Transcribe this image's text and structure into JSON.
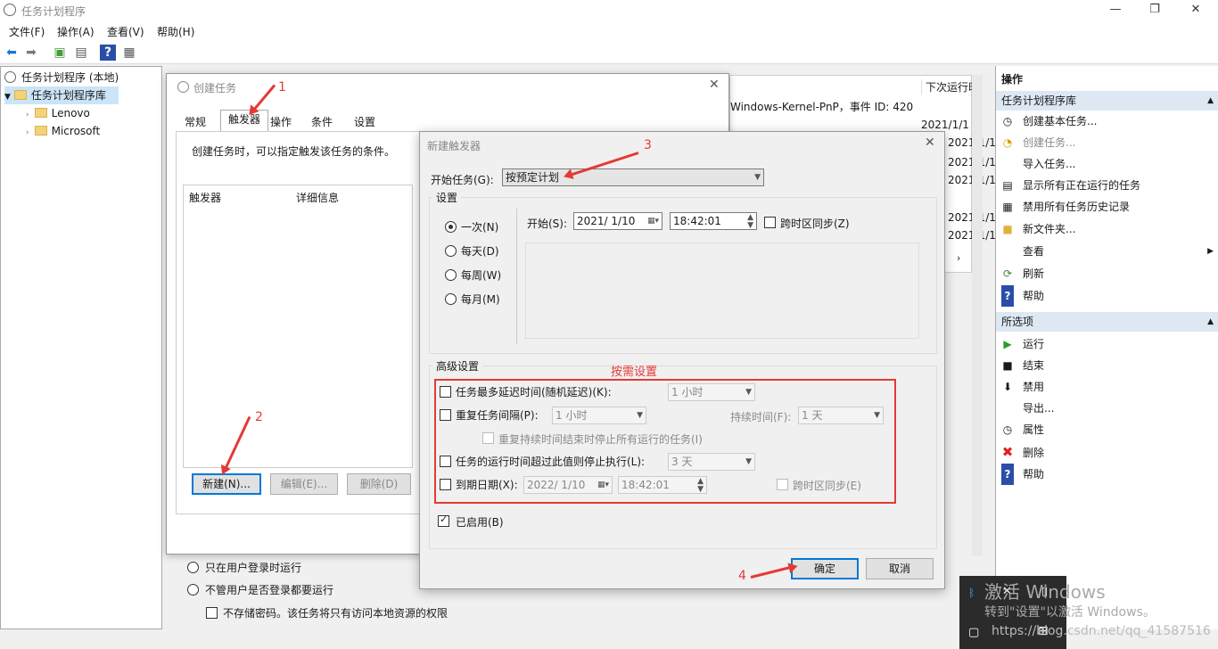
{
  "window": {
    "title": "任务计划程序"
  },
  "menu": [
    "文件(F)",
    "操作(A)",
    "查看(V)",
    "帮助(H)"
  ],
  "tree": {
    "root": "任务计划程序 (本地)",
    "library": "任务计划程序库",
    "children": [
      "Lenovo",
      "Microsoft"
    ]
  },
  "list": {
    "header": "下次运行时",
    "event": "Windows-Kernel-PnP，事件 ID: 420",
    "dates": [
      "2021/1/1",
      "2021/1/1(",
      "2021/1/1",
      "2021/1/1",
      "2021/1/1(",
      "2021/1/1("
    ]
  },
  "right": {
    "title": "操作",
    "section1": "任务计划程序库",
    "items1": [
      "创建基本任务...",
      "创建任务...",
      "导入任务...",
      "显示所有正在运行的任务",
      "禁用所有任务历史记录",
      "新文件夹...",
      "查看",
      "刷新",
      "帮助"
    ],
    "section2": "所选项",
    "items2": [
      "运行",
      "结束",
      "禁用",
      "导出...",
      "属性",
      "删除",
      "帮助"
    ]
  },
  "dlg1": {
    "title": "创建任务",
    "tabs": [
      "常规",
      "触发器",
      "操作",
      "条件",
      "设置"
    ],
    "desc": "创建任务时，可以指定触发该任务的条件。",
    "cols": [
      "触发器",
      "详细信息"
    ],
    "buttons": [
      "新建(N)...",
      "编辑(E)...",
      "删除(D)"
    ]
  },
  "bg": {
    "opt1": "只在用户登录时运行",
    "opt2": "不管用户是否登录都要运行",
    "opt3": "不存储密码。该任务将只有访问本地资源的权限"
  },
  "dlg2": {
    "title": "新建触发器",
    "start_label": "开始任务(G):",
    "start_value": "按预定计划",
    "settings": "设置",
    "radios": [
      "一次(N)",
      "每天(D)",
      "每周(W)",
      "每月(M)"
    ],
    "start_at": "开始(S):",
    "date": "2021/ 1/10",
    "time": "18:42:01",
    "sync": "跨时区同步(Z)",
    "advanced": "高级设置",
    "delay": "任务最多延迟时间(随机延迟)(K):",
    "delay_val": "1 小时",
    "repeat": "重复任务间隔(P):",
    "repeat_val": "1 小时",
    "duration": "持续时间(F):",
    "duration_val": "1 天",
    "stop_all": "重复持续时间结束时停止所有运行的任务(I)",
    "stop_if": "任务的运行时间超过此值则停止执行(L):",
    "stop_val": "3 天",
    "expire": "到期日期(X):",
    "expire_date": "2022/ 1/10",
    "expire_time": "18:42:01",
    "expire_sync": "跨时区同步(E)",
    "enabled": "已启用(B)",
    "ok": "确定",
    "cancel": "取消"
  },
  "annotations": {
    "n1": "1",
    "n2": "2",
    "n3": "3",
    "n4": "4",
    "note": "按需设置"
  },
  "watermark": {
    "line1": "激活 Windows",
    "line2": "转到\"设置\"以激活 Windows。",
    "url": "https://blog.csdn.net/qq_41587516"
  }
}
